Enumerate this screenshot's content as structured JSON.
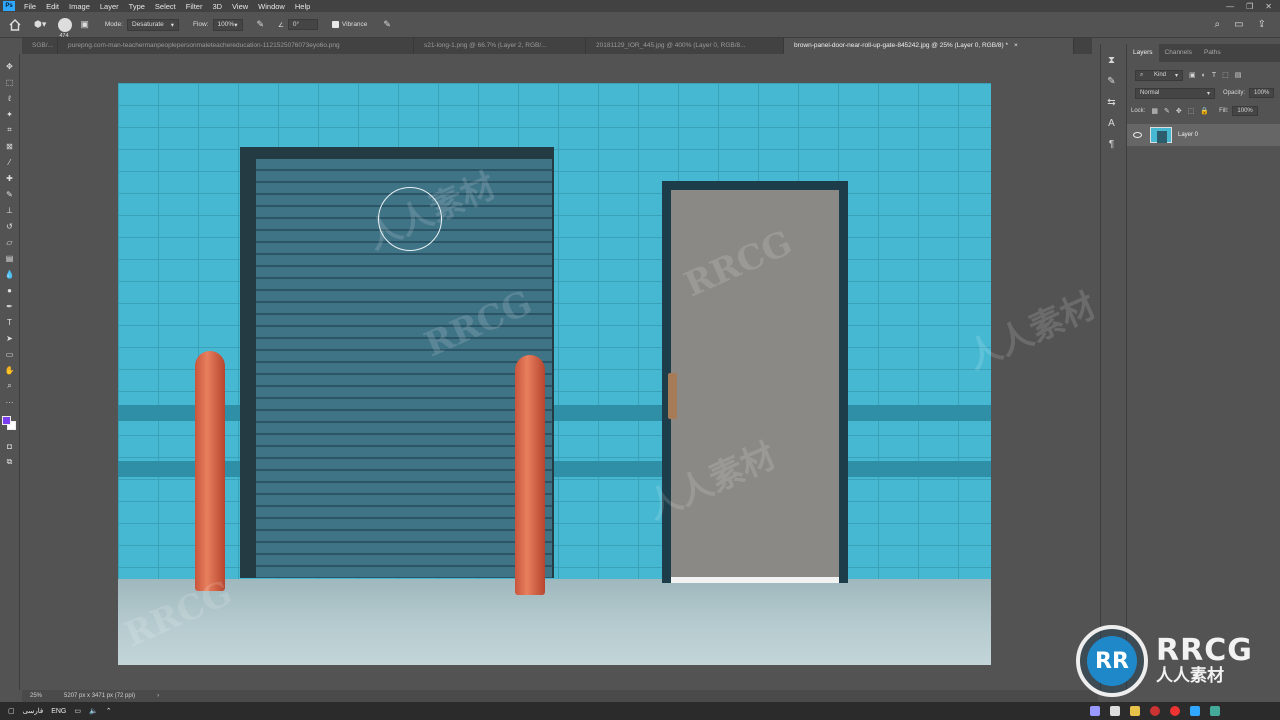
{
  "app": {
    "logo_text": "Ps",
    "menu": [
      "File",
      "Edit",
      "Image",
      "Layer",
      "Type",
      "Select",
      "Filter",
      "3D",
      "View",
      "Window",
      "Help"
    ],
    "window_controls": [
      "—",
      "❐",
      "✕"
    ]
  },
  "options_bar": {
    "brush_size": "474",
    "mode_label": "Mode:",
    "mode_value": "Desaturate",
    "flow_label": "Flow:",
    "flow_value": "100%",
    "angle_value": "0°",
    "vibrance_label": "Vibrance"
  },
  "tabs": [
    {
      "label": "SGB/...",
      "active": false
    },
    {
      "label": "purepng.com-man-teachermanpeoplepersonmaleteachereducation-1121525076073eyo6o.png",
      "active": false
    },
    {
      "label": "s21-long-1.png @ 66.7% (Layer 2, RGB/...",
      "active": false
    },
    {
      "label": "20181129_IOR_445.jpg @ 400% (Layer 0, RGB/8...",
      "active": false
    },
    {
      "label": "brown-panel-door-near-roll-up-gate-845242.jpg @ 25% (Layer 0, RGB/8) *",
      "active": true
    }
  ],
  "tools": [
    "move-icon",
    "marquee-icon",
    "lasso-icon",
    "magic-wand-icon",
    "crop-icon",
    "frame-icon",
    "eyedropper-icon",
    "healing-icon",
    "brush-icon",
    "stamp-icon",
    "history-brush-icon",
    "eraser-icon",
    "gradient-icon",
    "blur-icon",
    "sponge-icon",
    "pen-icon",
    "type-icon",
    "path-select-icon",
    "rectangle-icon",
    "hand-icon",
    "zoom-icon",
    "more-icon"
  ],
  "colors": {
    "foreground": "#7b3df0",
    "background": "#ffffff",
    "wall": "#46b8d2",
    "garage_door": "#3c6d80",
    "door": "#8b8985",
    "bollard": "#d9664a"
  },
  "layers_panel": {
    "tabs": [
      "Layers",
      "Channels",
      "Paths"
    ],
    "kind_label": "Kind",
    "blend_mode": "Normal",
    "opacity_label": "Opacity:",
    "opacity_value": "100%",
    "lock_label": "Lock:",
    "fill_label": "Fill:",
    "fill_value": "100%",
    "layers": [
      {
        "name": "Layer 0",
        "visible": true
      }
    ]
  },
  "status": {
    "zoom": "25%",
    "doc_info": "5207 px x 3471 px (72 ppi)"
  },
  "taskbar": {
    "language": "ENG",
    "keyboard": "فارسی"
  },
  "watermark": {
    "text_latin": "RRCG",
    "text_cjk": "人人素材"
  }
}
